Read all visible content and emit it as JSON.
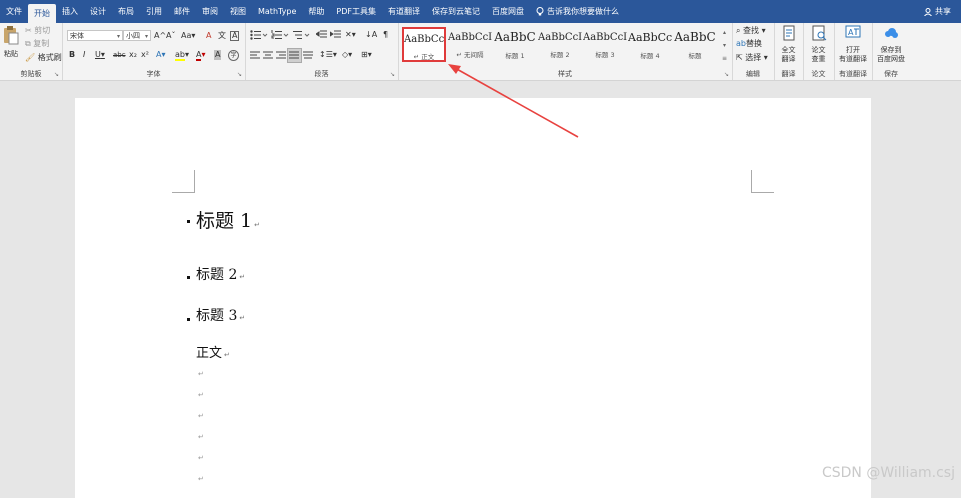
{
  "menubar": {
    "tabs": [
      "文件",
      "开始",
      "插入",
      "设计",
      "布局",
      "引用",
      "邮件",
      "审阅",
      "视图",
      "MathType",
      "帮助",
      "PDF工具集",
      "有道翻译",
      "保存到云笔记",
      "百度网盘"
    ],
    "tell_me": "告诉我你想要做什么",
    "share": "共享",
    "active_tab": "开始"
  },
  "clipboard": {
    "paste": "粘贴",
    "cut": "剪切",
    "copy": "复制",
    "format_painter": "格式刷",
    "label": "剪贴板"
  },
  "font": {
    "name": "宋体",
    "size": "小四",
    "grow": "A",
    "shrink": "A",
    "case": "Aa",
    "clear": "A",
    "wen": "文",
    "bold": "B",
    "italic": "I",
    "underline": "U",
    "strike": "abc",
    "sub": "x₂",
    "sup": "x²",
    "effects": "A",
    "highlight": "ab",
    "color": "A",
    "char_shade": "A",
    "encircle": "字",
    "label": "字体"
  },
  "paragraph": {
    "label": "段落"
  },
  "styles": {
    "label": "样式",
    "items": [
      {
        "sample": "AaBbCcI",
        "name": "↵ 正文"
      },
      {
        "sample": "AaBbCcI",
        "name": "↵ 无间隔"
      },
      {
        "sample": "AaBbC",
        "name": "标题 1"
      },
      {
        "sample": "AaBbCcI",
        "name": "标题 2"
      },
      {
        "sample": "AaBbCcI",
        "name": "标题 3"
      },
      {
        "sample": "AaBbCc",
        "name": "标题 4"
      },
      {
        "sample": "AaBbC",
        "name": "标题"
      }
    ]
  },
  "editing": {
    "find": "查找",
    "replace": "替换",
    "select": "选择",
    "label": "编辑"
  },
  "translate": {
    "full_text": [
      "全文",
      "翻译"
    ],
    "paper": [
      "论文",
      "查重"
    ],
    "open_translate": [
      "打开",
      "有道翻译"
    ],
    "group_full": "翻译",
    "group_paper": "论文",
    "group_youdao": "有道翻译"
  },
  "save_baidu": {
    "label": [
      "保存到",
      "百度网盘"
    ],
    "group": "保存"
  },
  "document": {
    "h1": "标题 1",
    "h2": "标题 2",
    "h3": "标题 3",
    "body": "正文"
  },
  "watermark": "CSDN @William.csj",
  "colors": {
    "brand": "#2b579a",
    "highlight_box": "#e03b3b",
    "arrow": "#e8423f"
  }
}
